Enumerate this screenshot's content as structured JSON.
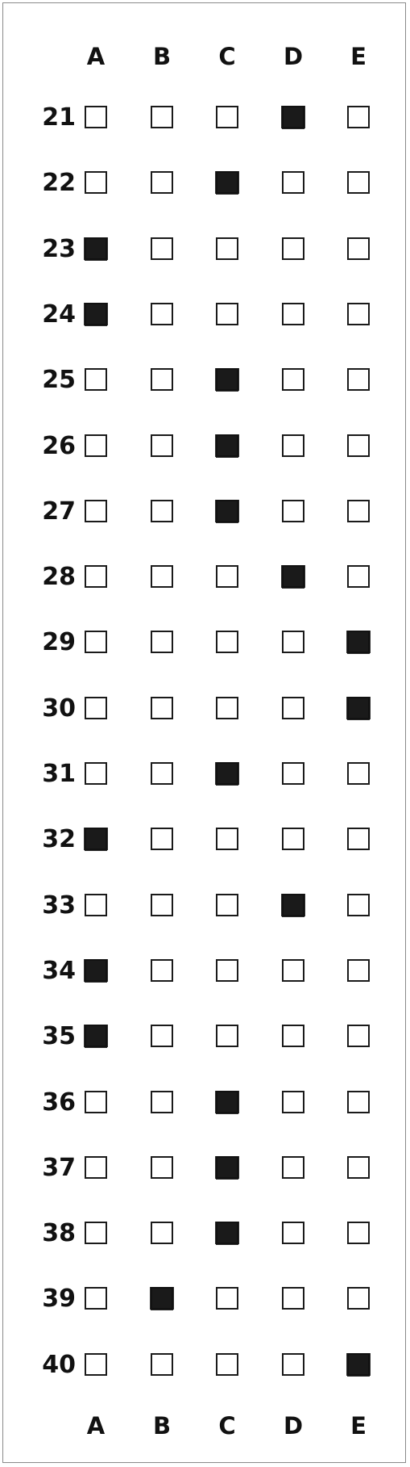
{
  "columns": [
    "A",
    "B",
    "C",
    "D",
    "E"
  ],
  "questions": [
    {
      "number": "21",
      "marked": "D"
    },
    {
      "number": "22",
      "marked": "C"
    },
    {
      "number": "23",
      "marked": "A"
    },
    {
      "number": "24",
      "marked": "A"
    },
    {
      "number": "25",
      "marked": "C"
    },
    {
      "number": "26",
      "marked": "C"
    },
    {
      "number": "27",
      "marked": "C"
    },
    {
      "number": "28",
      "marked": "D"
    },
    {
      "number": "29",
      "marked": "E"
    },
    {
      "number": "30",
      "marked": "E"
    },
    {
      "number": "31",
      "marked": "C"
    },
    {
      "number": "32",
      "marked": "A"
    },
    {
      "number": "33",
      "marked": "D"
    },
    {
      "number": "34",
      "marked": "A"
    },
    {
      "number": "35",
      "marked": "A"
    },
    {
      "number": "36",
      "marked": "C"
    },
    {
      "number": "37",
      "marked": "C"
    },
    {
      "number": "38",
      "marked": "C"
    },
    {
      "number": "39",
      "marked": "B"
    },
    {
      "number": "40",
      "marked": "E"
    }
  ]
}
